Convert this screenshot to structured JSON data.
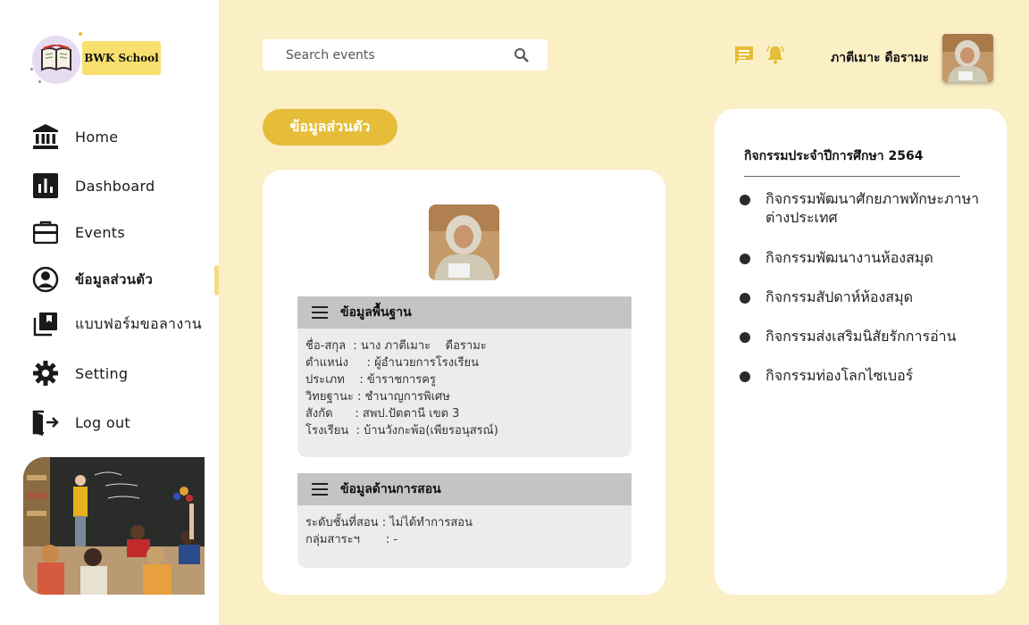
{
  "sidebar": {
    "logo_text": "BWK School",
    "nav": [
      {
        "label": "Home",
        "icon": "bank-icon"
      },
      {
        "label": "Dashboard",
        "icon": "bar-chart-icon"
      },
      {
        "label": "Events",
        "icon": "briefcase-icon"
      },
      {
        "label": "ข้อมูลส่วนตัว",
        "icon": "user-circle-icon",
        "active": true
      },
      {
        "label": "แบบฟอร์มขอลางาน",
        "icon": "library-books-icon"
      },
      {
        "label": "Setting",
        "icon": "gear-icon"
      },
      {
        "label": "Log out",
        "icon": "logout-icon"
      }
    ]
  },
  "header": {
    "search_placeholder": "Search events",
    "user_name": "ภาตีเมาะ ดือรามะ"
  },
  "page_title": "ข้อมูลส่วนตัว",
  "basic_info": {
    "title": "ข้อมูลพื้นฐาน",
    "rows": [
      {
        "key": "ชื่อ-สกุล  : ",
        "value": "นาง ภาตีเมาะ    ดือรามะ"
      },
      {
        "key": "ตำแหน่ง     : ",
        "value": "ผู้อำนวยการโรงเรียน"
      },
      {
        "key": "ประเภท    : ",
        "value": "ข้าราชการครู"
      },
      {
        "key": "วิทยฐานะ : ",
        "value": "ชำนาญการพิเศษ"
      },
      {
        "key": "สังกัด      : ",
        "value": "สพป.ปัตตานี เขต 3"
      },
      {
        "key": "โรงเรียน  : ",
        "value": "บ้านวังกะพ้อ(เพียรอนุสรณ์)"
      }
    ]
  },
  "teaching_info": {
    "title": "ข้อมูลด้านการสอน",
    "rows": [
      {
        "key": "ระดับชั้นที่สอน : ",
        "value": "ไม่ได้ทำการสอน"
      },
      {
        "key": "กลุ่มสาระฯ       : ",
        "value": "-"
      }
    ]
  },
  "activities": {
    "title": "กิจกรรมประจำปีการศึกษา 2564",
    "items": [
      "กิจกรรมพัฒนาศักยภาพทักษะภาษาต่างประเทศ",
      "กิจกรรมพัฒนางานห้องสมุด",
      "กิจกรรมสัปดาห์ห้องสมุด",
      "กิจกรรมส่งเสริมนิสัยรักการอ่าน",
      "กิจกรรมท่องโลกไซเบอร์"
    ]
  },
  "colors": {
    "background": "#fbefc6",
    "accent": "#e6bd38",
    "logo_badge": "#f8df70"
  }
}
